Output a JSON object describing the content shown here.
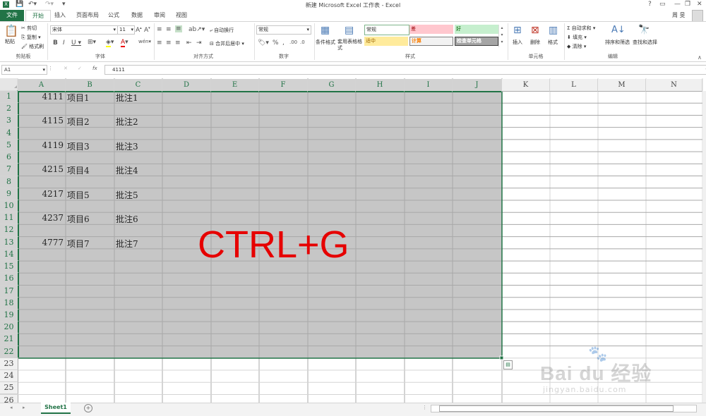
{
  "window": {
    "title": "新建 Microsoft Excel 工作表 - Excel",
    "user": "周 旻",
    "help": "?"
  },
  "tabs": [
    "文件",
    "开始",
    "插入",
    "页面布局",
    "公式",
    "数据",
    "审阅",
    "视图"
  ],
  "ribbon": {
    "clipboard": {
      "paste": "粘贴",
      "cut": "剪切",
      "copy": "复制",
      "format_painter": "格式刷",
      "label": "剪贴板"
    },
    "font": {
      "name": "宋体",
      "size": "11",
      "label": "字体"
    },
    "alignment": {
      "wrap": "自动换行",
      "merge": "合并后居中",
      "label": "对齐方式"
    },
    "number": {
      "format": "常规",
      "label": "数字"
    },
    "styles": {
      "conditional": "条件格式",
      "table": "套用表格格式",
      "normal": "常规",
      "bad": "差",
      "good": "好",
      "neutral": "适中",
      "calc": "计算",
      "check": "检查单元格",
      "label": "样式"
    },
    "cells": {
      "insert": "插入",
      "delete": "删除",
      "format": "格式",
      "label": "单元格"
    },
    "editing": {
      "autosum": "自动求和",
      "fill": "填充",
      "clear": "清除",
      "sort": "排序和筛选",
      "find": "查找和选择",
      "label": "编辑"
    }
  },
  "formula_bar": {
    "name_box": "A1",
    "fx": "fx",
    "value": "4111"
  },
  "columns": [
    "A",
    "B",
    "C",
    "D",
    "E",
    "F",
    "G",
    "H",
    "I",
    "J",
    "K",
    "L",
    "M",
    "N"
  ],
  "rows": [
    "1",
    "2",
    "3",
    "4",
    "5",
    "6",
    "7",
    "8",
    "9",
    "10",
    "11",
    "12",
    "13",
    "14",
    "15",
    "16",
    "17",
    "18",
    "19",
    "20",
    "21",
    "22",
    "23",
    "24",
    "25",
    "26"
  ],
  "cells": [
    {
      "a": "4111",
      "b": "项目1",
      "c": "批注1"
    },
    {
      "a": "4115",
      "b": "项目2",
      "c": "批注2"
    },
    {
      "a": "4119",
      "b": "项目3",
      "c": "批注3"
    },
    {
      "a": "4215",
      "b": "项目4",
      "c": "批注4"
    },
    {
      "a": "4217",
      "b": "项目5",
      "c": "批注5"
    },
    {
      "a": "4237",
      "b": "项目6",
      "c": "批注6"
    },
    {
      "a": "4777",
      "b": "项目7",
      "c": "批注7"
    }
  ],
  "overlay": {
    "text": "CTRL+G",
    "color": "#e60000"
  },
  "sheet_tab": "Sheet1",
  "watermark": {
    "brand": "Bai du 经验",
    "url": "jingyan.baidu.com"
  },
  "colors": {
    "accent": "#217346",
    "selection": "#c6c6c6"
  }
}
